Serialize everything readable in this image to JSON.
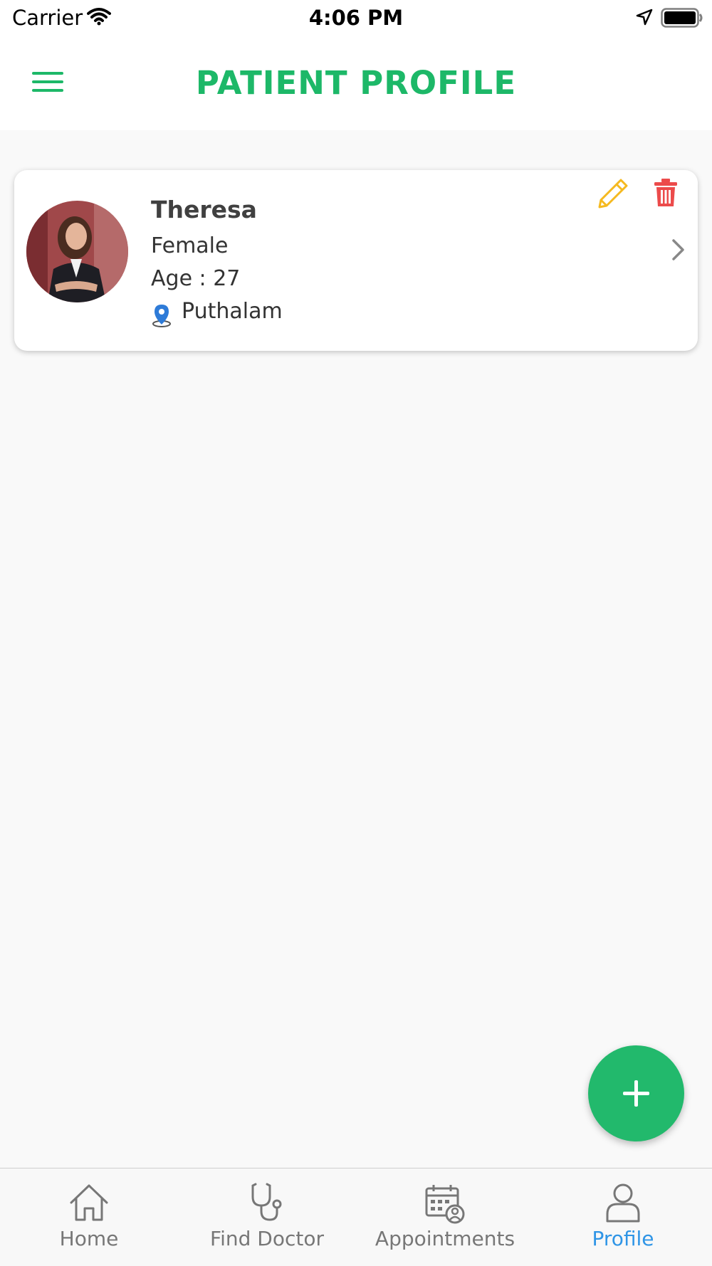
{
  "status_bar": {
    "carrier": "Carrier",
    "time": "4:06 PM"
  },
  "header": {
    "title": "PATIENT PROFILE"
  },
  "patient": {
    "name": "Theresa",
    "gender": "Female",
    "age_label": "Age : 27",
    "location": "Puthalam"
  },
  "tabs": [
    {
      "label": "Home",
      "icon": "home-icon"
    },
    {
      "label": "Find Doctor",
      "icon": "stethoscope-icon"
    },
    {
      "label": "Appointments",
      "icon": "calendar-icon"
    },
    {
      "label": "Profile",
      "icon": "user-icon"
    }
  ],
  "active_tab": "Profile",
  "colors": {
    "brand_green": "#1db868",
    "active_tab_blue": "#2f95e6",
    "edit_yellow": "#f5b91f",
    "delete_red": "#ec4b4b",
    "location_blue": "#2e7bd8"
  }
}
